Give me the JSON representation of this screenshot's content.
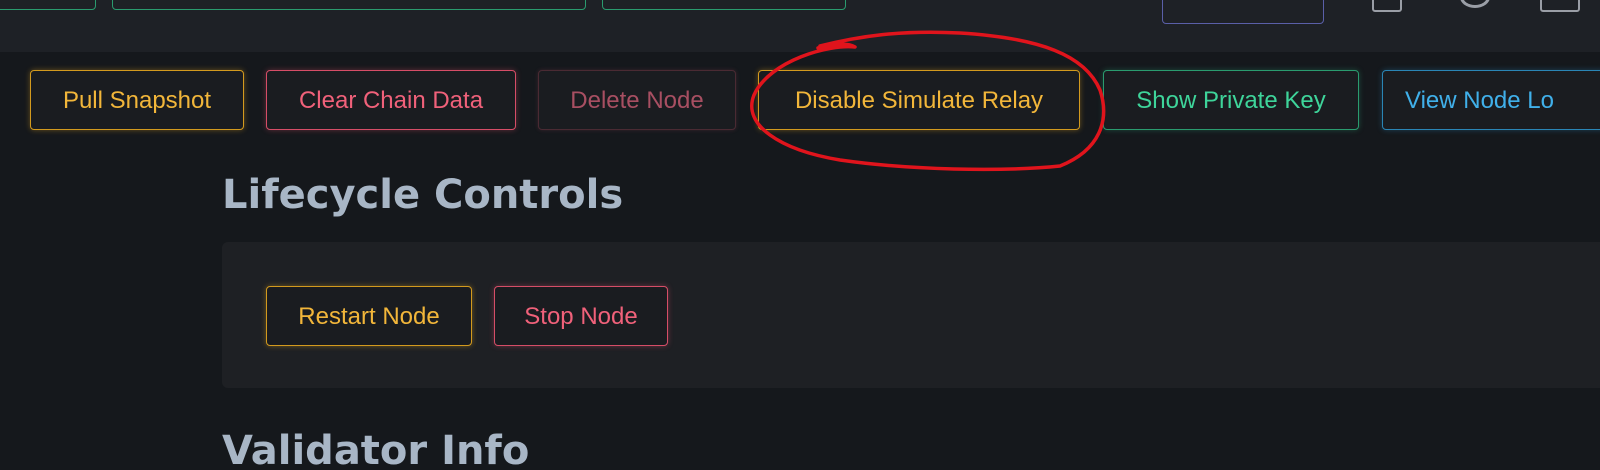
{
  "toolbar": {
    "buttons": [
      {
        "label": "Pull Snapshot",
        "color": "#f2b63a"
      },
      {
        "label": "Clear Chain Data",
        "color": "#f0617a"
      },
      {
        "label": "Delete Node",
        "color": "#a84f62"
      },
      {
        "label": "Disable Simulate Relay",
        "color": "#f2b63a"
      },
      {
        "label": "Show Private Key",
        "color": "#3ed49a"
      },
      {
        "label": "View Node Lo",
        "color": "#40b0ea"
      }
    ]
  },
  "lifecycle": {
    "title": "Lifecycle Controls",
    "buttons": [
      {
        "label": "Restart Node",
        "color": "#f2b63a"
      },
      {
        "label": "Stop Node",
        "color": "#f0617a"
      }
    ]
  },
  "validator": {
    "title": "Validator Info"
  },
  "annotation": {
    "color": "#e0141c"
  },
  "icons": [
    "calendar-icon",
    "clock-icon",
    "panel-icon"
  ]
}
